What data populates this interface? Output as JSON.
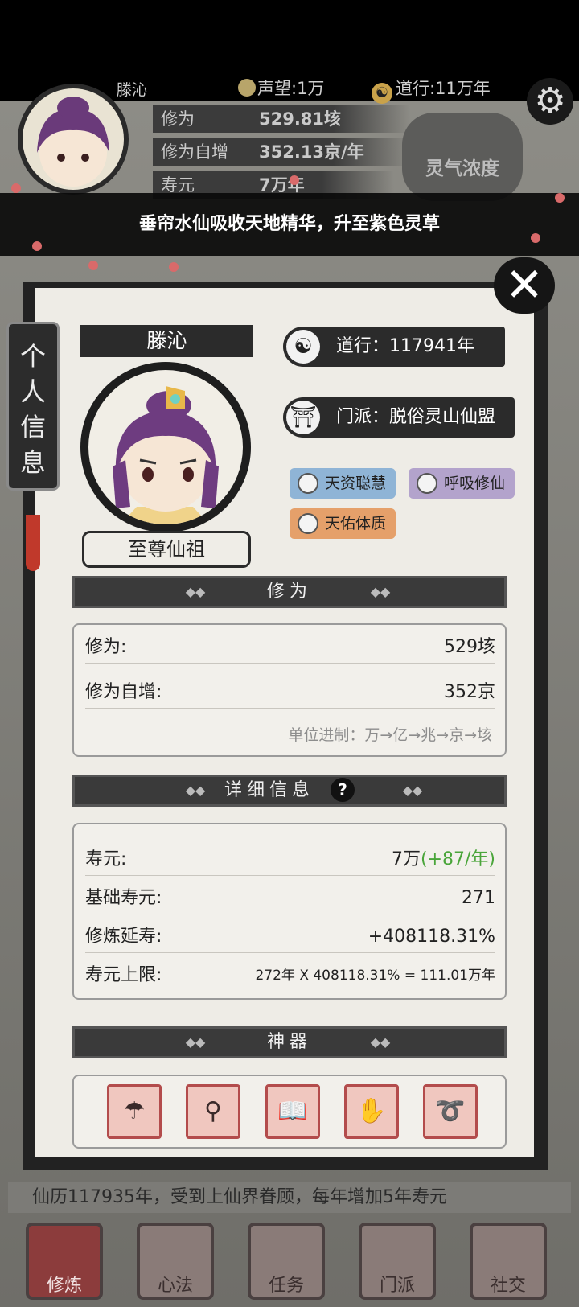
{
  "header": {
    "name": "滕沁",
    "fame": "声望:1万",
    "dao": "道行:11万年",
    "cultivation_label": "修为",
    "cultivation_value": "529.81垓",
    "growth_label": "修为自增",
    "growth_value": "352.13京/年",
    "life_label": "寿元",
    "life_value": "7万年",
    "lingqi": "灵气浓度",
    "settings_icon": "gear-icon"
  },
  "banner": {
    "text": "垂帘水仙吸收天地精华，升至紫色灵草"
  },
  "side_tab": {
    "label": "个人信息"
  },
  "profile": {
    "name": "滕沁",
    "title": "至尊仙祖",
    "dao_line": "道行：117941年",
    "sect_line": "门派：脱俗灵山仙盟",
    "traits": [
      {
        "label": "天资聪慧",
        "color": "#8fb4d6"
      },
      {
        "label": "呼吸修仙",
        "color": "#b3a3cc"
      },
      {
        "label": "天佑体质",
        "color": "#e5a06a"
      }
    ]
  },
  "cultivation": {
    "header": "修为",
    "rows": [
      {
        "label": "修为:",
        "value": "529垓"
      },
      {
        "label": "修为自增:",
        "value": "352京"
      }
    ],
    "note": "单位进制：万→亿→兆→京→垓"
  },
  "details": {
    "header": "详细信息",
    "help_icon": "question-icon",
    "lifespan_label": "寿元:",
    "lifespan_value": "7万",
    "lifespan_gain": "(+87/年)",
    "base_label": "基础寿元:",
    "base_value": "271",
    "extend_label": "修炼延寿:",
    "extend_value": "+408118.31%",
    "limit_label": "寿元上限:",
    "limit_value": "272年 X 408118.31% = 111.01万年"
  },
  "artifacts": {
    "header": "神器",
    "items": [
      "umbrella-artifact",
      "jade-token-artifact",
      "scroll-book-artifact",
      "gauntlet-artifact",
      "whip-artifact"
    ]
  },
  "footer": {
    "scroll_text": "仙历117935年，受到上仙界眷顾，每年增加5年寿元"
  },
  "nav": [
    {
      "label": "修炼"
    },
    {
      "label": "心法"
    },
    {
      "label": "任务"
    },
    {
      "label": "门派"
    },
    {
      "label": "社交"
    }
  ]
}
